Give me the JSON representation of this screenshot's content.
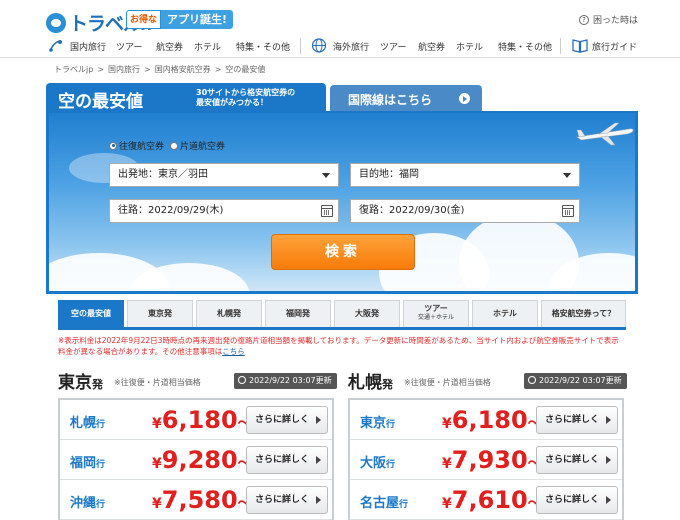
{
  "header": {
    "logo_text": "トラベル",
    "logo_suffix": "jp",
    "app_badge_small": "お得な",
    "app_badge": "アプリ誕生!",
    "help": "困った時は"
  },
  "nav": {
    "domestic": [
      "国内旅行",
      "ツアー",
      "航空券",
      "ホテル",
      "特集・その他"
    ],
    "overseas": [
      "海外旅行",
      "ツアー",
      "航空券",
      "ホテル",
      "特集・その他"
    ],
    "guide": "旅行ガイド"
  },
  "breadcrumb": [
    "トラベルjp",
    "国内旅行",
    "国内格安航空券",
    "空の最安値"
  ],
  "search": {
    "tab_title": "空の最安値",
    "tab_tagline_1": "30サイトから格安航空券の",
    "tab_tagline_2": "最安値がみつかる！",
    "intl_tab": "国際線はこちら",
    "trip_round": "往復航空券",
    "trip_oneway": "片道航空券",
    "origin": "出発地：東京／羽田",
    "destination": "目的地：福岡",
    "outbound": "往路：2022/09/29(木)",
    "return": "復路：2022/09/30(金)",
    "search_button": "検索"
  },
  "category_tabs": [
    {
      "label": "空の最安値",
      "sub": ""
    },
    {
      "label": "東京発",
      "sub": ""
    },
    {
      "label": "札幌発",
      "sub": ""
    },
    {
      "label": "福岡発",
      "sub": ""
    },
    {
      "label": "大阪発",
      "sub": ""
    },
    {
      "label": "ツアー",
      "sub": "交通＋ホテル"
    },
    {
      "label": "ホテル",
      "sub": ""
    },
    {
      "label": "格安航空券って？",
      "sub": ""
    }
  ],
  "notice": {
    "text": "※表示料金は2022年9月22日3時時点の再来週出発の復路片道相当額を掲載しております。データ更新に時間差があるため、当サイト内および航空券販売サイトで表示料金が異なる場合があります。その他注意事項は",
    "link": "こちら"
  },
  "sections": [
    {
      "city": "東京",
      "hatsu": "発",
      "note": "※往復便・片道相当価格",
      "updated": "2022/9/22 03:07更新",
      "rows": [
        {
          "dest": "札幌",
          "suffix": "行",
          "yen": "¥",
          "price": "6,180",
          "tilde": "〜",
          "button": "さらに詳しく"
        },
        {
          "dest": "福岡",
          "suffix": "行",
          "yen": "¥",
          "price": "9,280",
          "tilde": "〜",
          "button": "さらに詳しく"
        },
        {
          "dest": "沖縄",
          "suffix": "行",
          "yen": "¥",
          "price": "7,580",
          "tilde": "〜",
          "button": "さらに詳しく"
        }
      ]
    },
    {
      "city": "札幌",
      "hatsu": "発",
      "note": "※往復便・片道相当価格",
      "updated": "2022/9/22 03:07更新",
      "rows": [
        {
          "dest": "東京",
          "suffix": "行",
          "yen": "¥",
          "price": "6,180",
          "tilde": "〜",
          "button": "さらに詳しく"
        },
        {
          "dest": "大阪",
          "suffix": "行",
          "yen": "¥",
          "price": "7,930",
          "tilde": "〜",
          "button": "さらに詳しく"
        },
        {
          "dest": "名古屋",
          "suffix": "行",
          "yen": "¥",
          "price": "7,610",
          "tilde": "〜",
          "button": "さらに詳しく"
        }
      ]
    }
  ],
  "colors": {
    "brand_blue": "#1b78c8",
    "price_red": "#e01f1f",
    "search_orange": "#f77c0a"
  }
}
